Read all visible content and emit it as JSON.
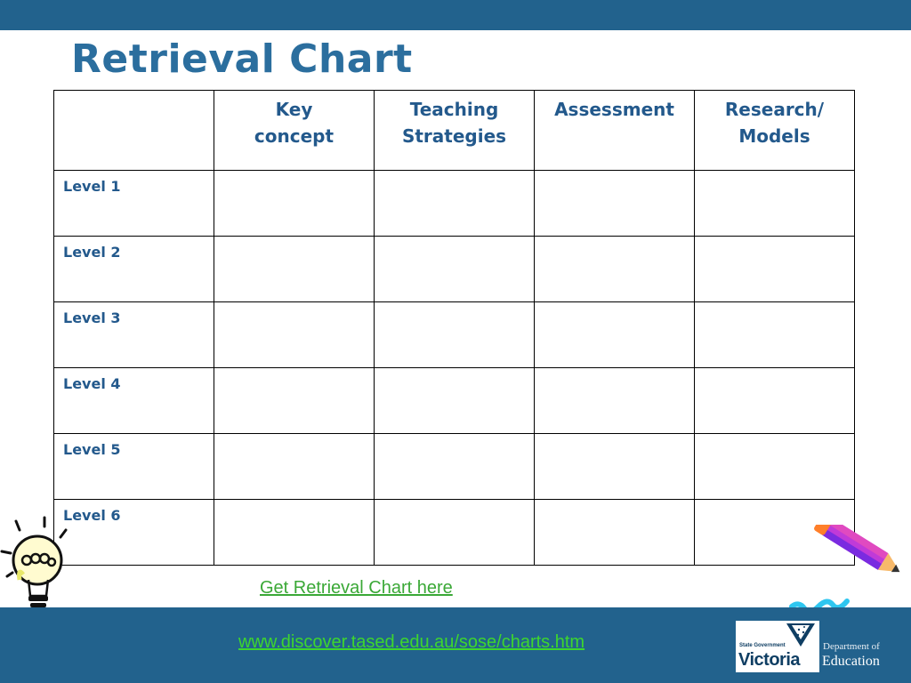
{
  "slide": {
    "title": "Retrieval Chart",
    "title_mark": " ",
    "colors": {
      "bar": "#22628d",
      "title": "#2b6e9e",
      "table_text": "#23598c",
      "link": "#3aa836"
    }
  },
  "table": {
    "headers": [
      "",
      "Key\nconcept",
      "Teaching\nStrategies",
      "Assessment",
      "Research/\nModels"
    ],
    "rows": [
      "Level 1",
      "Level 2",
      "Level 3",
      "Level 4",
      "Level 5",
      "Level 6"
    ]
  },
  "links": {
    "retrieval": "Get Retrieval Chart here",
    "url": "www.discover.tased.edu.au/sose/charts.htm"
  },
  "logo": {
    "state_government": "State Government",
    "victoria": "Victoria",
    "department": "Department of",
    "education": "Education"
  },
  "icons": {
    "bulb": "lightbulb-icon",
    "pencil": "pencil-icon"
  }
}
